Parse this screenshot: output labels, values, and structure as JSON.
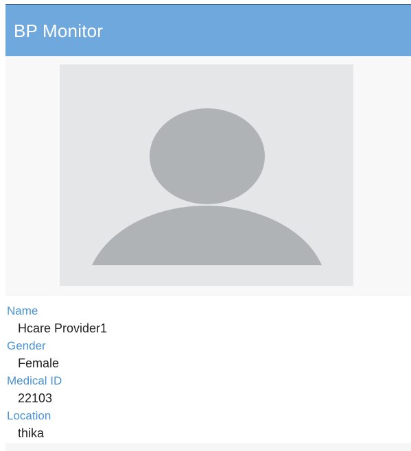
{
  "app_bar": {
    "title": "BP Monitor",
    "color": "#6ea8dd"
  },
  "profile": {
    "avatar_icon": "default-person-avatar",
    "fields": [
      {
        "label": "Name",
        "value": "Hcare Provider1"
      },
      {
        "label": "Gender",
        "value": "Female"
      },
      {
        "label": "Medical ID",
        "value": "22103"
      },
      {
        "label": "Location",
        "value": "thika"
      }
    ]
  },
  "colors": {
    "label": "#4a93d2",
    "value": "#202020",
    "avatar_bg": "#e5e6e7",
    "avatar_shape": "#b0b3b6"
  }
}
